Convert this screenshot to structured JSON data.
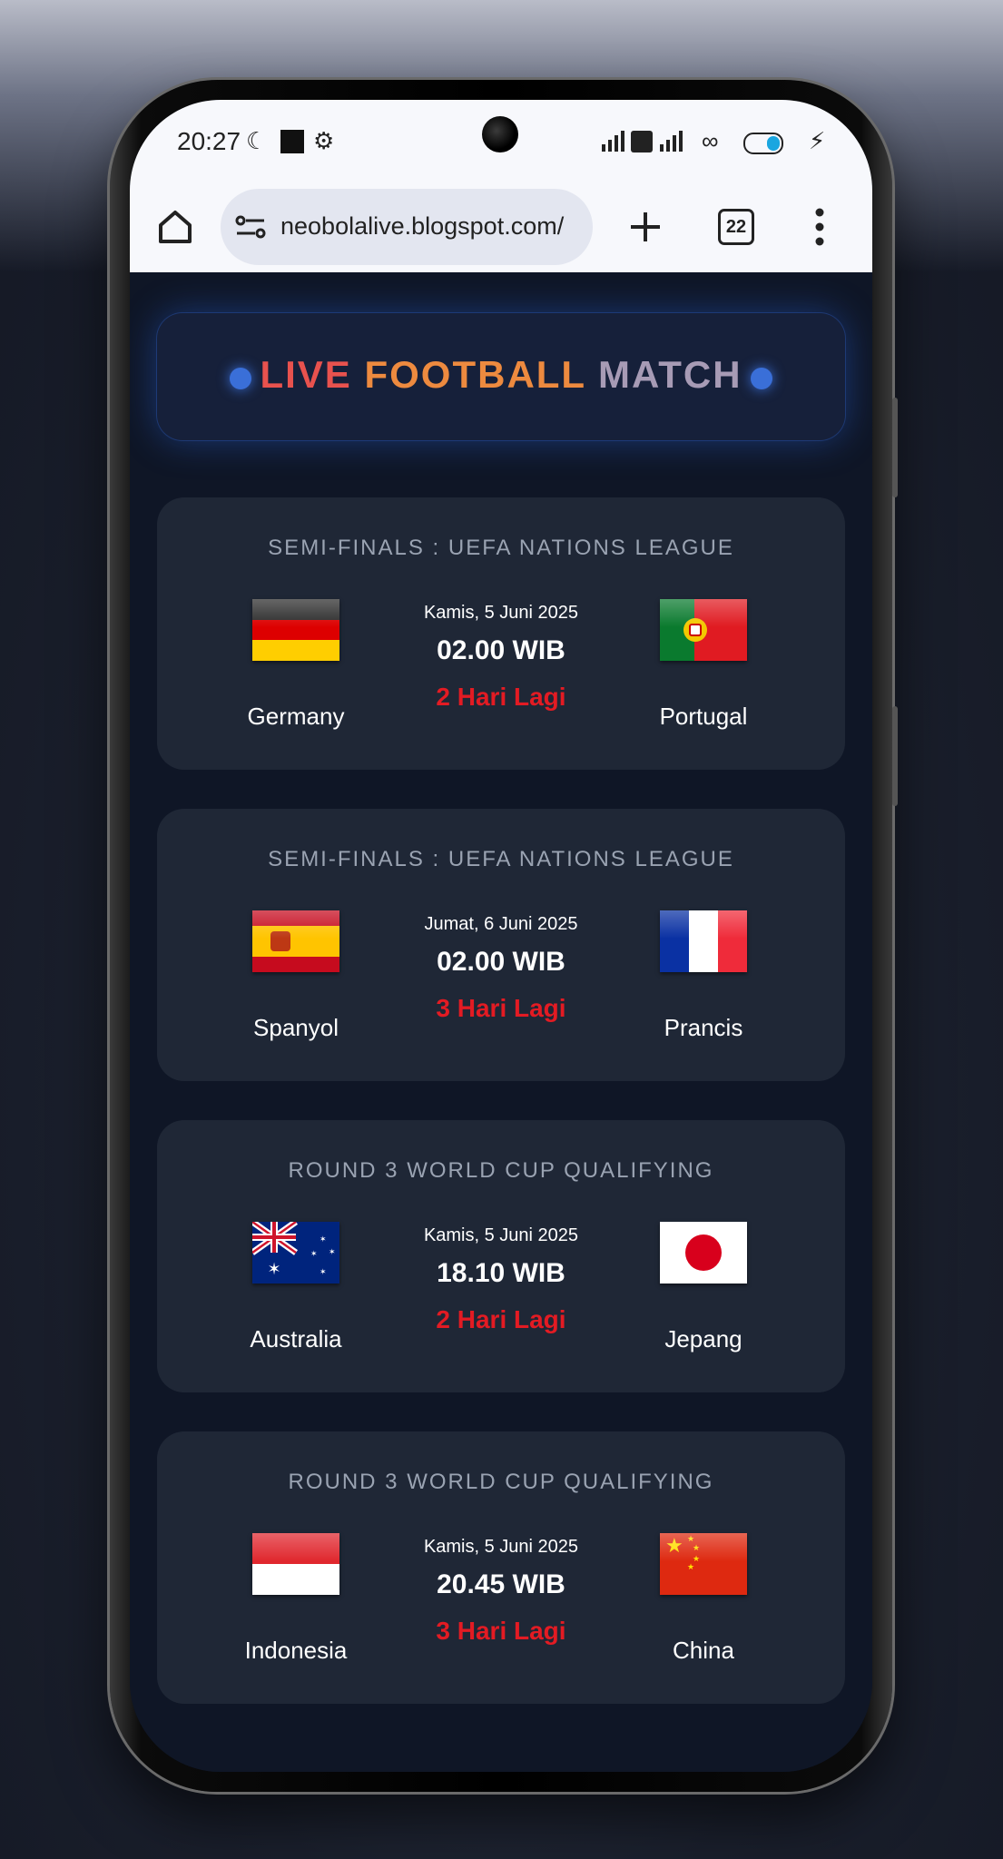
{
  "statusbar": {
    "time": "20:27"
  },
  "browser": {
    "url": "neobolalive.blogspot.com/",
    "tab_count": "22"
  },
  "hero": {
    "title_part1": "LIVE",
    "title_part2": "FOOTBALL",
    "title_part3": "MATCH"
  },
  "matches": [
    {
      "league": "SEMI-FINALS : UEFA NATIONS LEAGUE",
      "date": "Kamis, 5 Juni 2025",
      "time": "02.00 WIB",
      "countdown": "2 Hari Lagi",
      "home": "Germany",
      "away": "Portugal"
    },
    {
      "league": "SEMI-FINALS : UEFA NATIONS LEAGUE",
      "date": "Jumat, 6 Juni 2025",
      "time": "02.00 WIB",
      "countdown": "3 Hari Lagi",
      "home": "Spanyol",
      "away": "Prancis"
    },
    {
      "league": "ROUND 3 WORLD CUP QUALIFYING",
      "date": "Kamis, 5 Juni 2025",
      "time": "18.10 WIB",
      "countdown": "2 Hari Lagi",
      "home": "Australia",
      "away": "Jepang"
    },
    {
      "league": "ROUND 3 WORLD CUP QUALIFYING",
      "date": "Kamis, 5 Juni 2025",
      "time": "20.45 WIB",
      "countdown": "3 Hari Lagi",
      "home": "Indonesia",
      "away": "China"
    }
  ],
  "colors": {
    "countdown": "#e31b23",
    "card_bg": "#1f2736",
    "page_bg": "#0f1626",
    "accent_dot": "#3a6fd8"
  }
}
